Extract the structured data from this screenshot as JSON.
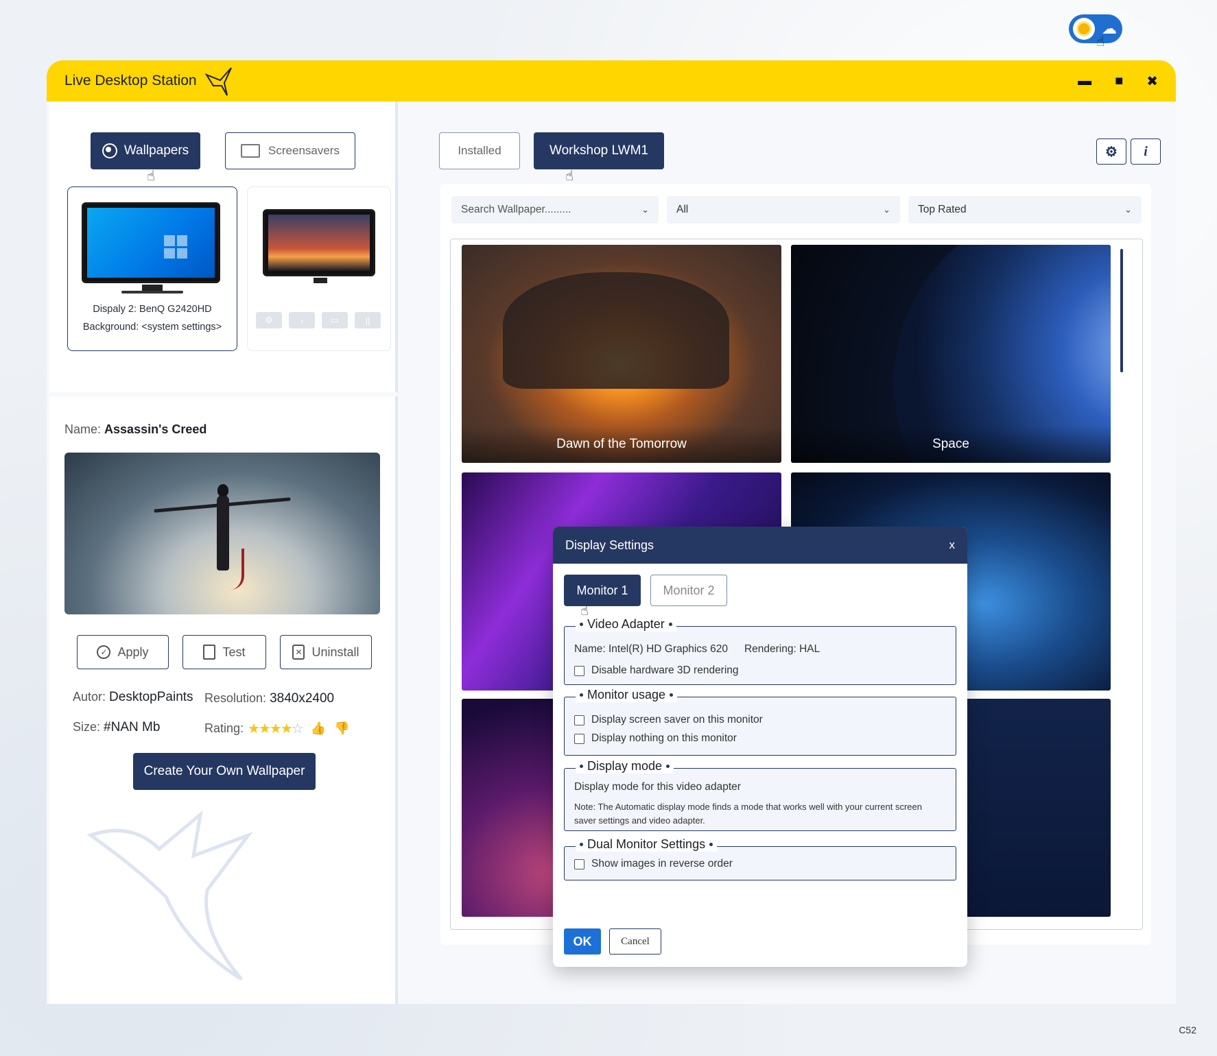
{
  "app": {
    "title": "Live Desktop Station",
    "window_controls": {
      "minimize": "▬",
      "maximize": "■",
      "close": "✖"
    }
  },
  "theme_toggle": {
    "state": "light",
    "icons": [
      "sun-icon",
      "cloud-moon-icon"
    ]
  },
  "left_tabs": {
    "wallpapers": "Wallpapers",
    "screensavers": "Screensavers",
    "active": "wallpapers"
  },
  "monitors": [
    {
      "label_line1": "Dispaly 2: BenQ G2420HD",
      "label_line2": "Background: <system settings>",
      "selected": true
    },
    {
      "controls": [
        "⚙",
        "›",
        "▭",
        "||"
      ],
      "selected": false
    }
  ],
  "details": {
    "name_label": "Name:",
    "name_value": "Assassin's Creed",
    "actions": {
      "apply": "Apply",
      "test": "Test",
      "uninstall": "Uninstall"
    },
    "author_label": "Autor:",
    "author_value": "DesktopPaints",
    "resolution_label": "Resolution:",
    "resolution_value": "3840x2400",
    "size_label": "Size:",
    "size_value": "#NAN Mb",
    "rating_label": "Rating:",
    "rating_value": 4,
    "rating_max": 5,
    "stars_filled": "★★★★",
    "stars_empty": "☆",
    "create_button": "Create Your Own Wallpaper"
  },
  "right_tabs": {
    "installed": "Installed",
    "workshop": "Workshop LWM1",
    "active": "workshop"
  },
  "right_icons": {
    "settings": "⚙",
    "info": "i"
  },
  "filters": {
    "search_placeholder": "Search Wallpaper.........",
    "category": "All",
    "sort": "Top Rated"
  },
  "wallpapers": [
    {
      "title": "Dawn of the Tomorrow"
    },
    {
      "title": "Space"
    }
  ],
  "dialog": {
    "title": "Display Settings",
    "close": "x",
    "monitor_tabs": [
      "Monitor 1",
      "Monitor 2"
    ],
    "active_tab": "Monitor 1",
    "video_adapter": {
      "legend": "Video Adapter",
      "name": "Name: Intel(R) HD Graphics 620",
      "rendering": "Rendering: HAL",
      "disable_hw": "Disable hardware 3D rendering"
    },
    "monitor_usage": {
      "legend": "Monitor usage",
      "screensaver": "Display screen saver on this monitor",
      "nothing": "Display nothing on this monitor"
    },
    "display_mode": {
      "legend": "Display mode",
      "label": "Display mode for this video adapter",
      "note": "Note: The Automatic display mode finds a mode that works well with your current screen saver settings and video adapter."
    },
    "dual_monitor": {
      "legend": "Dual Monitor Settings",
      "reverse": "Show images in reverse order"
    },
    "ok": "OK",
    "cancel": "Cancel"
  },
  "corner_code": "C52"
}
